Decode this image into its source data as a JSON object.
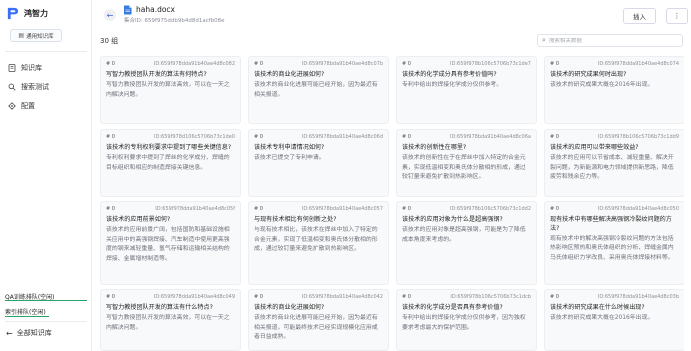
{
  "app": {
    "name": "鸿智力",
    "kb_button": "通用知识库"
  },
  "sidebar": {
    "items": [
      {
        "label": "知识库",
        "icon": "book-icon"
      },
      {
        "label": "搜索测试",
        "icon": "search-icon"
      },
      {
        "label": "配置",
        "icon": "gear-icon"
      }
    ],
    "queues": [
      {
        "label": "QA训练排队(空闲)"
      },
      {
        "label": "索引排队(空闲)"
      }
    ],
    "all_kb": "全部知识库"
  },
  "header": {
    "file_name": "haha.docx",
    "set_id": "集合ID: 659f975ddb9b4d8d1acfb08e",
    "insert": "插入",
    "more": "⋮"
  },
  "toolbar": {
    "count": "30 组",
    "search_placeholder": "搜索相关数据"
  },
  "cards": [
    {
      "idx": "# 0",
      "id": "ID:659f978dda91b40ae4d8c082",
      "q": "写智力教授团队开发的算法有何特点?",
      "a": "写智力教授团队开发的算法高效，可以在一天之内解决问题。"
    },
    {
      "idx": "# 0",
      "id": "ID:659f978bda91b40ae4d8c07b",
      "q": "该技术的商业化进展如何?",
      "a": "该技术的商业化进展可能已经开始，因为最近有相关报道。"
    },
    {
      "idx": "# 0",
      "id": "ID:659f978b106c5706b73c1de7",
      "q": "该技术的化学成分具有参考价值吗?",
      "a": "专利中给出的焊接化学成分仅供参考。"
    },
    {
      "idx": "# 0",
      "id": "ID:659f978dda91b40ae4d8c074",
      "q": "该技术的研究成果何时出现?",
      "a": "该技术的研究成果大概在2016年出现。"
    },
    {
      "idx": "# 0",
      "id": "ID:659f978d106c5706b73c1de0",
      "q": "该技术的专利权利要求中提到了哪些关键信息?",
      "a": "专利权利要求中提到了焊丝的化学成分、焊缝的目标组织和相应的制造焊接关键信息。"
    },
    {
      "idx": "# 0",
      "id": "ID:659f978bda91b40ae4d8c06d",
      "q": "该技术专利申请情况如何?",
      "a": "该技术已提交了专利申请。"
    },
    {
      "idx": "# 0",
      "id": "ID:659f978bda91b40ae4d8c06a",
      "q": "该技术的创新性在哪里?",
      "a": "该技术的创新性在于在焊丝中加入特定的合金元素，实现低温相变和奥氏体分散相的形成，通过较钉量来避免扩散到热影响区。"
    },
    {
      "idx": "# 0",
      "id": "ID:659f978b106c5706b73c1dd9",
      "q": "该技术的应用可以带来哪些效益?",
      "a": "该技术的应用可以节省成本、减轻重量、解决开裂问题，为新能源和电力领域提供新思路，降低疲劳和残余应力等。"
    },
    {
      "idx": "# 0",
      "id": "ID:659f978dda91b40ae4d8c05f",
      "q": "该技术的应用前景如何?",
      "a": "该技术的应用前景广阔，包括国防和基础设施相关应用中的高强钢焊接、汽车制造中使用更高强度的钢来减轻重量、氢气存储和运输相关结构的焊接、金属增材制造等。"
    },
    {
      "idx": "# 0",
      "id": "ID:659f978bda91b40ae4d8c057",
      "q": "与现有技术相比有何创新之处?",
      "a": "与现有技术相比，该技术在焊丝中加入了特定的合金元素，实现了低温相变和奥氏体分散相的形成，通过较钉量来避免扩散到热影响区。"
    },
    {
      "idx": "# 0",
      "id": "ID:659f978b106c5706b73c1dd2",
      "q": "该技术的应用对象为什么是超高强钢?",
      "a": "该技术的应用对象是超高强钢，可能是为了降低成本角度来考虑的。"
    },
    {
      "idx": "# 0",
      "id": "ID:659f978dda91b40ae4d8c050",
      "q": "现有技术中有哪些解决高强钢冷裂纹问题的方法?",
      "a": "现有技术中的解决高强钢冷裂纹问题的方法包括热影响区预热和奥氏体组织的分析、焊缝金属内马氏体组织力学改良、采用奥氏体焊接材料等。"
    },
    {
      "idx": "# 0",
      "id": "ID:659f978dda91b40ae4d8c049",
      "q": "写智力教授团队开发的算法有什么特点?",
      "a": "写智力教授团队开发的算法高效，可以在一天之内解决问题。"
    },
    {
      "idx": "# 0",
      "id": "ID:659f978bda91b40ae4d8c042",
      "q": "该技术的商业化进展如何?",
      "a": "该技术的商业化进展可能已经开始，因为最近有相关报道，可能最终技术已经实现规模化应用或者日益成熟。"
    },
    {
      "idx": "# 0",
      "id": "ID:659f978b106c5706b73c1dcb",
      "q": "该技术的化学成分是否具有参考价值?",
      "a": "专利中给出的焊接化学成分仅供参考，因为独权要求考虑最大的保护范围。"
    },
    {
      "idx": "# 0",
      "id": "ID:659f978dda91b40ae4d8c03b",
      "q": "该技术的研究成果在什么时候出现?",
      "a": "该技术的研究成果大概在2016年出现。"
    }
  ]
}
